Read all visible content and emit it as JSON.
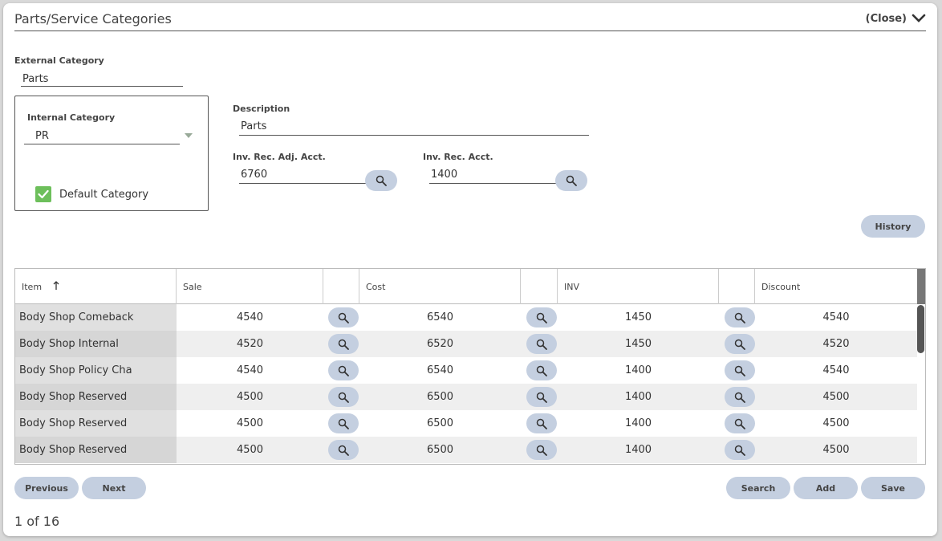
{
  "header": {
    "title": "Parts/Service Categories",
    "close_label": "(Close)"
  },
  "external_category": {
    "label": "External Category",
    "value": "Parts"
  },
  "internal_category": {
    "label": "Internal Category",
    "value": "PR",
    "default_label": "Default Category",
    "default_checked": true
  },
  "description": {
    "label": "Description",
    "value": "Parts"
  },
  "inv_rec_adj_acct": {
    "label": "Inv. Rec. Adj. Acct.",
    "value": "6760"
  },
  "inv_rec_acct": {
    "label": "Inv. Rec. Acct.",
    "value": "1400"
  },
  "history_label": "History",
  "table": {
    "columns": {
      "item": "Item",
      "sale": "Sale",
      "cost": "Cost",
      "inv": "INV",
      "discount": "Discount"
    },
    "rows": [
      {
        "item": "Body Shop Comeback",
        "sale": "4540",
        "cost": "6540",
        "inv": "1450",
        "discount": "4540"
      },
      {
        "item": "Body Shop Internal",
        "sale": "4520",
        "cost": "6520",
        "inv": "1450",
        "discount": "4520"
      },
      {
        "item": "Body Shop Policy Cha",
        "sale": "4540",
        "cost": "6540",
        "inv": "1400",
        "discount": "4540"
      },
      {
        "item": "Body Shop Reserved",
        "sale": "4500",
        "cost": "6500",
        "inv": "1400",
        "discount": "4500"
      },
      {
        "item": "Body Shop Reserved",
        "sale": "4500",
        "cost": "6500",
        "inv": "1400",
        "discount": "4500"
      },
      {
        "item": "Body Shop Reserved",
        "sale": "4500",
        "cost": "6500",
        "inv": "1400",
        "discount": "4500"
      }
    ]
  },
  "footer": {
    "previous_label": "Previous",
    "next_label": "Next",
    "search_label": "Search",
    "add_label": "Add",
    "save_label": "Save",
    "pager_text": "1 of 16"
  },
  "colors": {
    "button_bg": "#c4cfe0",
    "check_green": "#6dbf5b",
    "row_alt": "#efefef",
    "item_col_bg": "#e0e0e0"
  }
}
